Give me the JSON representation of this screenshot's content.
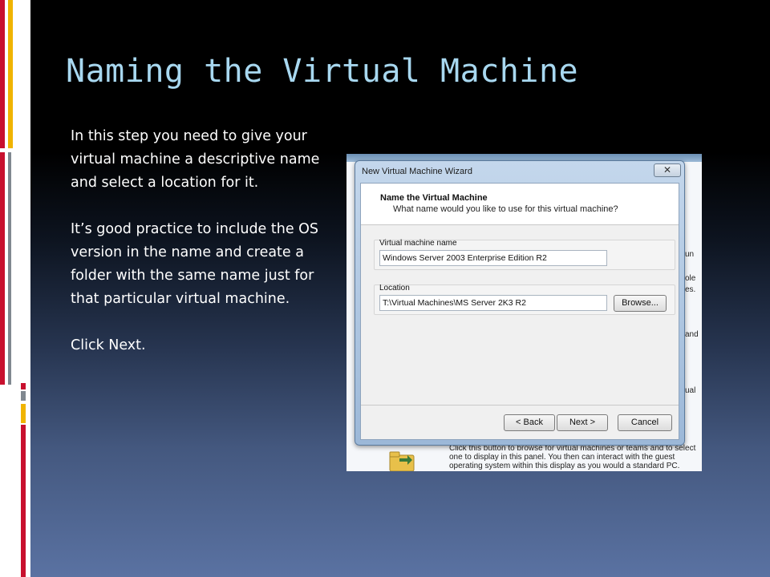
{
  "slide": {
    "title": "Naming the Virtual Machine",
    "paragraphs": [
      "In this step you need to give your virtual machine a descriptive name and select a location for it.",
      "It’s good practice to include the OS version in the name and create a folder with the same name just for that particular virtual machine.",
      "Click Next."
    ]
  },
  "wizard": {
    "window_title": "New Virtual Machine Wizard",
    "close_glyph": "✕",
    "header_title": "Name the Virtual Machine",
    "header_subtitle": "What name would you like to use for this virtual machine?",
    "name_group_label": "Virtual machine name",
    "name_value": "Windows Server 2003 Enterprise Edition R2",
    "location_group_label": "Location",
    "location_value": "T:\\Virtual Machines\\MS Server 2K3 R2",
    "browse_label": "Browse...",
    "back_label": "< Back",
    "next_label": "Next >",
    "cancel_label": "Cancel"
  },
  "background_app": {
    "right_fragments": [
      "un",
      "ole",
      "es.",
      "and",
      "ual"
    ],
    "bottom_text": "Click this button to browse for virtual machines or teams and to select one to display in this panel. You then can interact with the guest operating system within this display as you would a standard PC."
  },
  "colors": {
    "title": "#a8d8f0",
    "body_text": "#ffffff",
    "stripe_red": "#c8102e",
    "stripe_gold": "#f0b400",
    "stripe_gray": "#808890"
  }
}
